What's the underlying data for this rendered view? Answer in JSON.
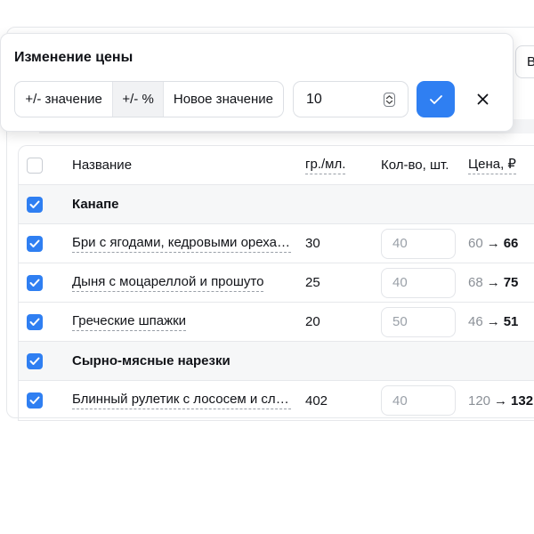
{
  "toolbar": {
    "partial_button_label": "В"
  },
  "popup": {
    "title": "Изменение цены",
    "modes": [
      "+/- значение",
      "+/- %",
      "Новое значение"
    ],
    "selected_mode": "+/- %",
    "value": "10",
    "accent_color": "#2f7ff2"
  },
  "table": {
    "headers": {
      "name": "Название",
      "weight": "гр./мл.",
      "quantity": "Кол-во, шт.",
      "price": "Цена, ₽"
    },
    "groups": [
      {
        "name": "Канапе",
        "checked": true,
        "items": [
          {
            "name": "Бри с ягодами, кедровыми орехами и медом",
            "weight": "30",
            "quantity": "40",
            "old_price": "60",
            "new_price": "66",
            "checked": true
          },
          {
            "name": "Дыня с моцареллой и прошуто",
            "weight": "25",
            "quantity": "40",
            "old_price": "68",
            "new_price": "75",
            "checked": true
          },
          {
            "name": "Греческие шпажки",
            "weight": "20",
            "quantity": "50",
            "old_price": "46",
            "new_price": "51",
            "checked": true
          }
        ]
      },
      {
        "name": "Сырно-мясные нарезки",
        "checked": true,
        "items": [
          {
            "name": "Блинный рулетик с лососем и сливочным сыром",
            "weight": "402",
            "quantity": "40",
            "old_price": "120",
            "new_price": "132",
            "checked": true
          }
        ]
      }
    ],
    "arrow": "→"
  }
}
